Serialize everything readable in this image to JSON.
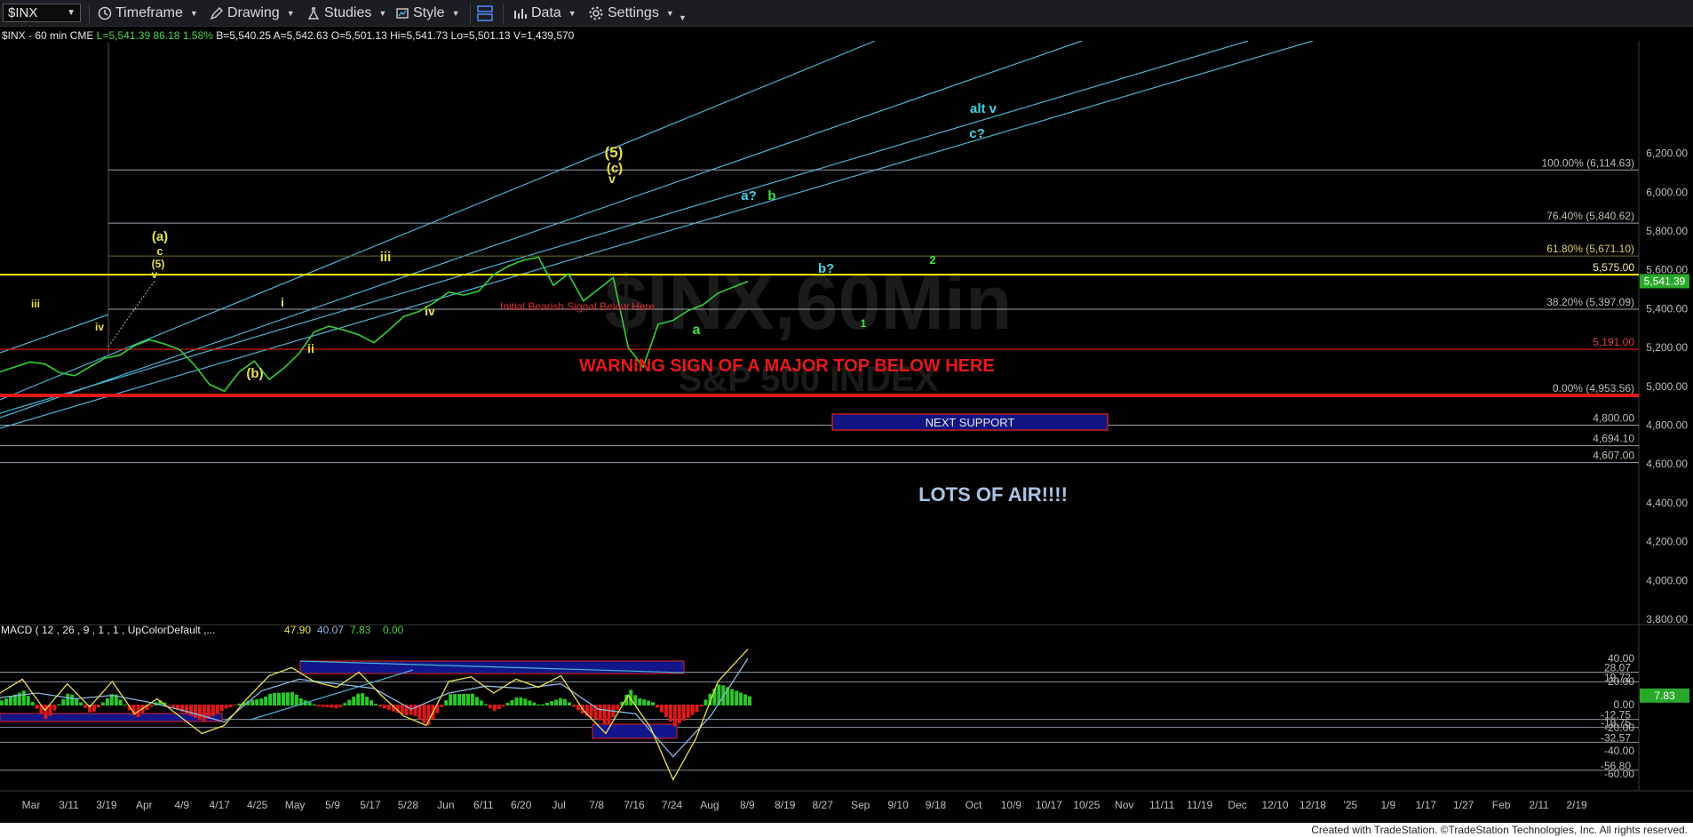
{
  "toolbar": {
    "symbol": "$INX",
    "timeframe": "Timeframe",
    "drawing": "Drawing",
    "studies": "Studies",
    "style": "Style",
    "data": "Data",
    "settings": "Settings"
  },
  "infobar": {
    "symbol_label": "$INX - 60 min",
    "exchange": "CME",
    "last": "L=5,541.39",
    "change": "86.18",
    "change_pct": "1.58%",
    "bid": "B=5,540.25",
    "ask": "A=5,542.63",
    "open": "O=5,501.13",
    "high": "Hi=5,541.73",
    "low": "Lo=5,501.13",
    "volume": "V=1,439,570"
  },
  "colors": {
    "price": "#35d135",
    "channel": "#4bb3d6",
    "yellow_line": "#f0f000",
    "red_line": "#e01818",
    "fib_line": "#9aa4b2",
    "wave_yellow": "#e9e24a",
    "wave_green": "#3fe23f",
    "wave_cyan": "#3fd6e8",
    "macd_fast": "#e9e24a",
    "macd_slow": "#8fb7e0"
  },
  "chart_data": {
    "type": "line",
    "title": "",
    "ylim": [
      3800,
      6250
    ],
    "yticks": [
      "6,200.00",
      "6,000.00",
      "5,800.00",
      "5,600.00",
      "5,400.00",
      "5,200.00",
      "5,000.00",
      "4,800.00",
      "4,600.00",
      "4,400.00",
      "4,200.00",
      "4,000.00",
      "3,800.00"
    ],
    "xticks": [
      "Mar",
      "3/11",
      "3/19",
      "Apr",
      "4/9",
      "4/17",
      "4/25",
      "May",
      "5/9",
      "5/17",
      "5/28",
      "Jun",
      "6/11",
      "6/20",
      "Jul",
      "7/8",
      "7/16",
      "7/24",
      "Aug",
      "8/9",
      "8/19",
      "8/27",
      "Sep",
      "9/10",
      "9/18",
      "Oct",
      "10/9",
      "10/17",
      "10/25",
      "Nov",
      "11/11",
      "11/19",
      "Dec",
      "12/10",
      "12/18",
      "'25",
      "1/9",
      "1/17",
      "1/27",
      "Feb",
      "2/11",
      "2/19"
    ],
    "last_price": "5,541.39",
    "series": [
      {
        "name": "$INX",
        "points": [
          [
            0,
            5075
          ],
          [
            0.02,
            5100
          ],
          [
            0.04,
            5125
          ],
          [
            0.06,
            5115
          ],
          [
            0.08,
            5070
          ],
          [
            0.1,
            5055
          ],
          [
            0.12,
            5100
          ],
          [
            0.14,
            5145
          ],
          [
            0.16,
            5160
          ],
          [
            0.18,
            5210
          ],
          [
            0.2,
            5240
          ],
          [
            0.22,
            5218
          ],
          [
            0.24,
            5190
          ],
          [
            0.26,
            5110
          ],
          [
            0.28,
            5010
          ],
          [
            0.3,
            4975
          ],
          [
            0.32,
            5075
          ],
          [
            0.34,
            5130
          ],
          [
            0.36,
            5035
          ],
          [
            0.38,
            5095
          ],
          [
            0.4,
            5170
          ],
          [
            0.42,
            5280
          ],
          [
            0.44,
            5310
          ],
          [
            0.46,
            5290
          ],
          [
            0.48,
            5265
          ],
          [
            0.5,
            5225
          ],
          [
            0.52,
            5290
          ],
          [
            0.54,
            5360
          ],
          [
            0.56,
            5385
          ],
          [
            0.58,
            5430
          ],
          [
            0.6,
            5485
          ],
          [
            0.62,
            5470
          ],
          [
            0.64,
            5490
          ],
          [
            0.66,
            5575
          ],
          [
            0.68,
            5620
          ],
          [
            0.7,
            5650
          ],
          [
            0.72,
            5665
          ],
          [
            0.74,
            5520
          ],
          [
            0.76,
            5580
          ],
          [
            0.78,
            5440
          ],
          [
            0.8,
            5500
          ],
          [
            0.82,
            5560
          ],
          [
            0.84,
            5200
          ],
          [
            0.86,
            5100
          ],
          [
            0.88,
            5320
          ],
          [
            0.9,
            5340
          ],
          [
            0.92,
            5390
          ],
          [
            0.94,
            5420
          ],
          [
            0.96,
            5480
          ],
          [
            1,
            5541
          ]
        ]
      }
    ],
    "horizontal_levels": [
      {
        "label": "100.00% (6,114.63)",
        "value": 6114.63,
        "kind": "fib"
      },
      {
        "label": "76.40% (5,840.62)",
        "value": 5840.62,
        "kind": "fib"
      },
      {
        "label": "61.80% (5,671.10)",
        "value": 5671.1,
        "kind": "fib_yellow"
      },
      {
        "label": "5,575.00",
        "value": 5575,
        "kind": "yellow"
      },
      {
        "label": "38.20% (5,397.09)",
        "value": 5397.09,
        "kind": "fib"
      },
      {
        "label": "5,191.00",
        "value": 5191,
        "kind": "red"
      },
      {
        "label": "0.00% (4,953.56)",
        "value": 4953.56,
        "kind": "red_thick"
      },
      {
        "label": "4,800.00",
        "value": 4800,
        "kind": "fib"
      },
      {
        "label": "4,694.10",
        "value": 4694.1,
        "kind": "fib"
      },
      {
        "label": "4,607.00",
        "value": 4607,
        "kind": "fib"
      }
    ],
    "annotations": {
      "warning": "WARNING SIGN OF A MAJOR TOP BELOW HERE",
      "initial_bearish": "Initial Bearish Signal Below Here",
      "next_support": "NEXT SUPPORT",
      "lots_of_air": "LOTS OF AIR!!!!",
      "watermark_main": "$INX,60Min",
      "watermark_sub": "S&P 500 INDEX"
    },
    "wave_labels": [
      {
        "text": "iii",
        "color": "wave_yellow"
      },
      {
        "text": "iv",
        "color": "wave_yellow"
      },
      {
        "text": "(a)",
        "color": "wave_yellow"
      },
      {
        "text": "c",
        "color": "wave_yellow"
      },
      {
        "text": "(5)",
        "color": "wave_yellow"
      },
      {
        "text": "v",
        "color": "wave_yellow"
      },
      {
        "text": "(b)",
        "color": "wave_yellow"
      },
      {
        "text": "i",
        "color": "wave_yellow"
      },
      {
        "text": "ii",
        "color": "wave_yellow"
      },
      {
        "text": "iii",
        "color": "wave_yellow"
      },
      {
        "text": "iv",
        "color": "wave_yellow"
      },
      {
        "text": "(5)",
        "color": "wave_yellow"
      },
      {
        "text": "(c)",
        "color": "wave_yellow"
      },
      {
        "text": "v",
        "color": "wave_yellow"
      },
      {
        "text": "a",
        "color": "wave_green"
      },
      {
        "text": "a?",
        "color": "wave_cyan"
      },
      {
        "text": "b",
        "color": "wave_green"
      },
      {
        "text": "b?",
        "color": "wave_cyan"
      },
      {
        "text": "2",
        "color": "wave_green"
      },
      {
        "text": "1",
        "color": "wave_green"
      },
      {
        "text": "alt v",
        "color": "wave_cyan"
      },
      {
        "text": "c?",
        "color": "wave_cyan"
      }
    ],
    "macd": {
      "header": "MACD ( 12 , 26 , 9 , 1 , 1 , UpColorDefault ,...",
      "values": [
        "47.90",
        "40.07",
        "7.83",
        "0.00"
      ],
      "ylim": [
        -70,
        50
      ],
      "yticks": [
        "40.00",
        "20.00",
        "0.00",
        "-20.00",
        "-40.00",
        "-60.00"
      ],
      "levels": [
        {
          "label": "28.07",
          "value": 28.07
        },
        {
          "label": "19.72",
          "value": 19.72
        },
        {
          "label": "-12.75",
          "value": -12.75
        },
        {
          "label": "-19.75",
          "value": -19.75
        },
        {
          "label": "-32.57",
          "value": -32.57
        },
        {
          "label": "-56.80",
          "value": -56.8
        }
      ],
      "current_hist": "7.83",
      "fast_line": [
        [
          0,
          10
        ],
        [
          0.03,
          22
        ],
        [
          0.06,
          -5
        ],
        [
          0.09,
          18
        ],
        [
          0.12,
          -2
        ],
        [
          0.15,
          20
        ],
        [
          0.18,
          -8
        ],
        [
          0.21,
          5
        ],
        [
          0.24,
          -10
        ],
        [
          0.27,
          -25
        ],
        [
          0.3,
          -18
        ],
        [
          0.33,
          5
        ],
        [
          0.36,
          25
        ],
        [
          0.39,
          32
        ],
        [
          0.42,
          20
        ],
        [
          0.45,
          15
        ],
        [
          0.48,
          28
        ],
        [
          0.51,
          8
        ],
        [
          0.54,
          -10
        ],
        [
          0.57,
          -18
        ],
        [
          0.6,
          20
        ],
        [
          0.63,
          24
        ],
        [
          0.66,
          10
        ],
        [
          0.69,
          22
        ],
        [
          0.72,
          15
        ],
        [
          0.75,
          25
        ],
        [
          0.78,
          -5
        ],
        [
          0.81,
          -25
        ],
        [
          0.84,
          8
        ],
        [
          0.87,
          -20
        ],
        [
          0.9,
          -65
        ],
        [
          0.93,
          -30
        ],
        [
          0.96,
          20
        ],
        [
          1,
          48
        ]
      ],
      "slow_line": [
        [
          0,
          6
        ],
        [
          0.05,
          10
        ],
        [
          0.1,
          5
        ],
        [
          0.15,
          8
        ],
        [
          0.2,
          2
        ],
        [
          0.25,
          -6
        ],
        [
          0.3,
          -15
        ],
        [
          0.35,
          12
        ],
        [
          0.4,
          22
        ],
        [
          0.45,
          18
        ],
        [
          0.5,
          14
        ],
        [
          0.55,
          -4
        ],
        [
          0.6,
          10
        ],
        [
          0.65,
          16
        ],
        [
          0.7,
          14
        ],
        [
          0.75,
          18
        ],
        [
          0.8,
          -4
        ],
        [
          0.85,
          -8
        ],
        [
          0.9,
          -45
        ],
        [
          0.95,
          -10
        ],
        [
          1,
          40
        ]
      ]
    }
  },
  "footer": {
    "credit": "Created with TradeStation. ©TradeStation Technologies, Inc. All rights reserved."
  }
}
